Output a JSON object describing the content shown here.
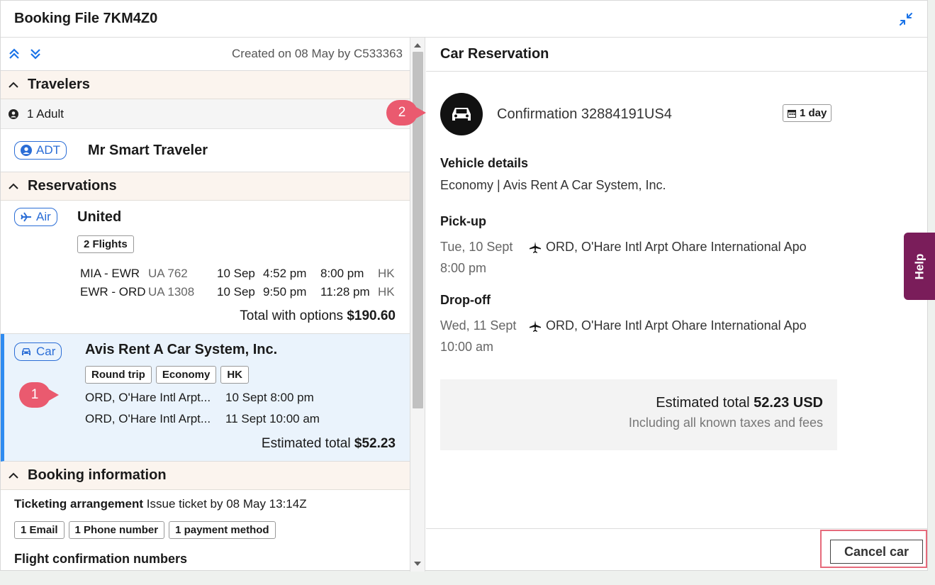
{
  "window": {
    "title": "Booking File 7KM4Z0"
  },
  "left": {
    "created": "Created on 08 May by C533363",
    "travelers": {
      "heading": "Travelers",
      "count": "1 Adult",
      "type": "ADT",
      "name": "Mr Smart Traveler"
    },
    "reservations": {
      "heading": "Reservations",
      "air": {
        "type": "Air",
        "vendor": "United",
        "tag": "2 Flights",
        "flights": [
          {
            "route": "MIA - EWR",
            "flight": "UA 762",
            "date": "10 Sep",
            "dep": "4:52 pm",
            "arr": "8:00 pm",
            "status": "HK"
          },
          {
            "route": "EWR - ORD",
            "flight": "UA 1308",
            "date": "10 Sep",
            "dep": "9:50 pm",
            "arr": "11:28 pm",
            "status": "HK"
          }
        ],
        "total_label": "Total with options",
        "total_value": "$190.60"
      },
      "car": {
        "type": "Car",
        "vendor": "Avis Rent A Car System, Inc.",
        "tags": [
          "Round trip",
          "Economy",
          "HK"
        ],
        "pickup_loc": "ORD, O'Hare Intl Arpt...",
        "pickup_time": "10 Sept 8:00 pm",
        "dropoff_loc": "ORD, O'Hare Intl Arpt...",
        "dropoff_time": "11 Sept 10:00 am",
        "total_label": "Estimated total",
        "total_value": "$52.23",
        "callout": "1"
      }
    },
    "booking_info": {
      "heading": "Booking information",
      "ticketing_label": "Ticketing arrangement",
      "ticketing_value": "Issue ticket by 08 May 13:14Z",
      "tags": [
        "1 Email",
        "1 Phone number",
        "1 payment method"
      ],
      "flight_conf_label": "Flight confirmation numbers"
    }
  },
  "right": {
    "heading": "Car Reservation",
    "callout": "2",
    "confirmation": "Confirmation 32884191US4",
    "duration": "1 day",
    "vehicle_label": "Vehicle details",
    "vehicle_value": "Economy | Avis Rent A Car System, Inc.",
    "pickup_label": "Pick-up",
    "pickup_date": "Tue, 10 Sept",
    "pickup_time": "8:00 pm",
    "pickup_loc": "ORD, O'Hare Intl Arpt Ohare International Apo",
    "dropoff_label": "Drop-off",
    "dropoff_date": "Wed, 11 Sept",
    "dropoff_time": "10:00 am",
    "dropoff_loc": "ORD, O'Hare Intl Arpt Ohare International Apo",
    "est_label": "Estimated total",
    "est_value": "52.23 USD",
    "est_note": "Including all known taxes and fees",
    "cancel": "Cancel car"
  },
  "help": "Help",
  "colors": {
    "accent": "#2a6dd6",
    "callout": "#ea5a6f",
    "help": "#7a1d5a",
    "section_bg": "#fbf4ee",
    "selected_bg": "#eaf3fc"
  }
}
